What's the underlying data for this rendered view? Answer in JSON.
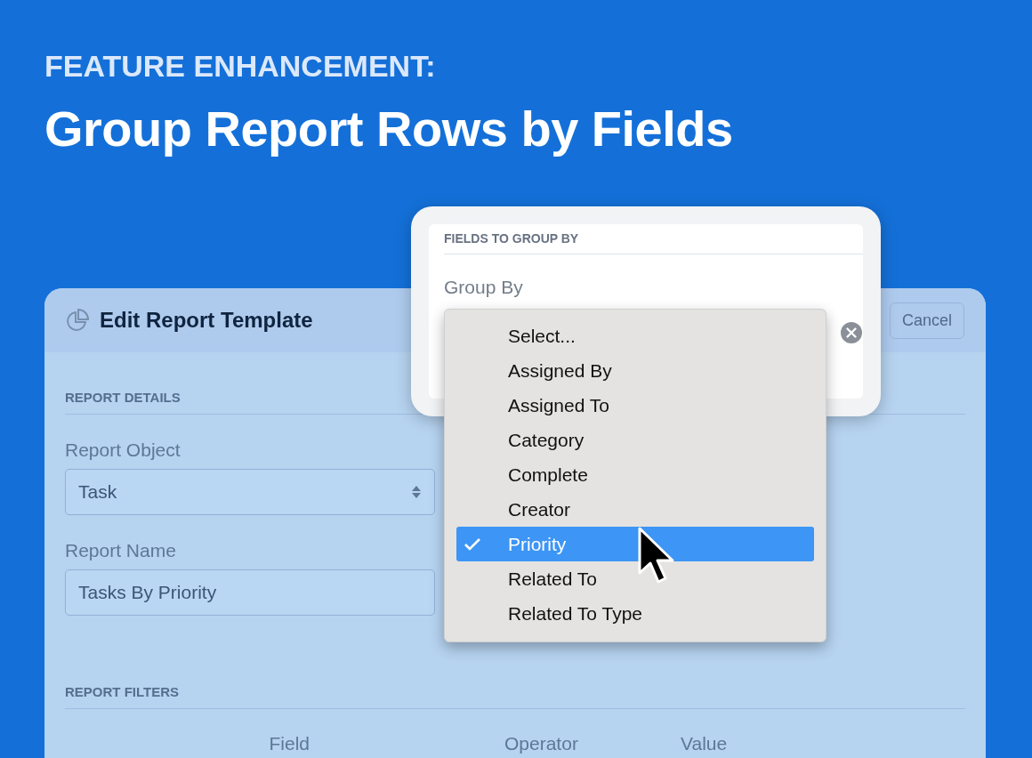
{
  "banner": {
    "kicker": "FEATURE ENHANCEMENT:",
    "title": "Group Report Rows by Fields"
  },
  "dialog": {
    "title": "Edit Report Template",
    "cancel": "Cancel",
    "details_heading": "REPORT DETAILS",
    "fields": [
      {
        "kind": "select",
        "label": "Report Object",
        "value": "Task"
      },
      {
        "kind": "text",
        "label": "Report Name",
        "value": "Tasks By Priority"
      }
    ],
    "filters_heading": "REPORT FILTERS",
    "filter_columns": [
      "Field",
      "Operator",
      "Value"
    ]
  },
  "group_popup": {
    "heading": "FIELDS TO GROUP BY",
    "label": "Group By",
    "options": [
      {
        "label": "Select...",
        "selected": false
      },
      {
        "label": "Assigned By",
        "selected": false
      },
      {
        "label": "Assigned To",
        "selected": false
      },
      {
        "label": "Category",
        "selected": false
      },
      {
        "label": "Complete",
        "selected": false
      },
      {
        "label": "Creator",
        "selected": false
      },
      {
        "label": "Priority",
        "selected": true
      },
      {
        "label": "Related To",
        "selected": false
      },
      {
        "label": "Related To Type",
        "selected": false
      }
    ]
  }
}
